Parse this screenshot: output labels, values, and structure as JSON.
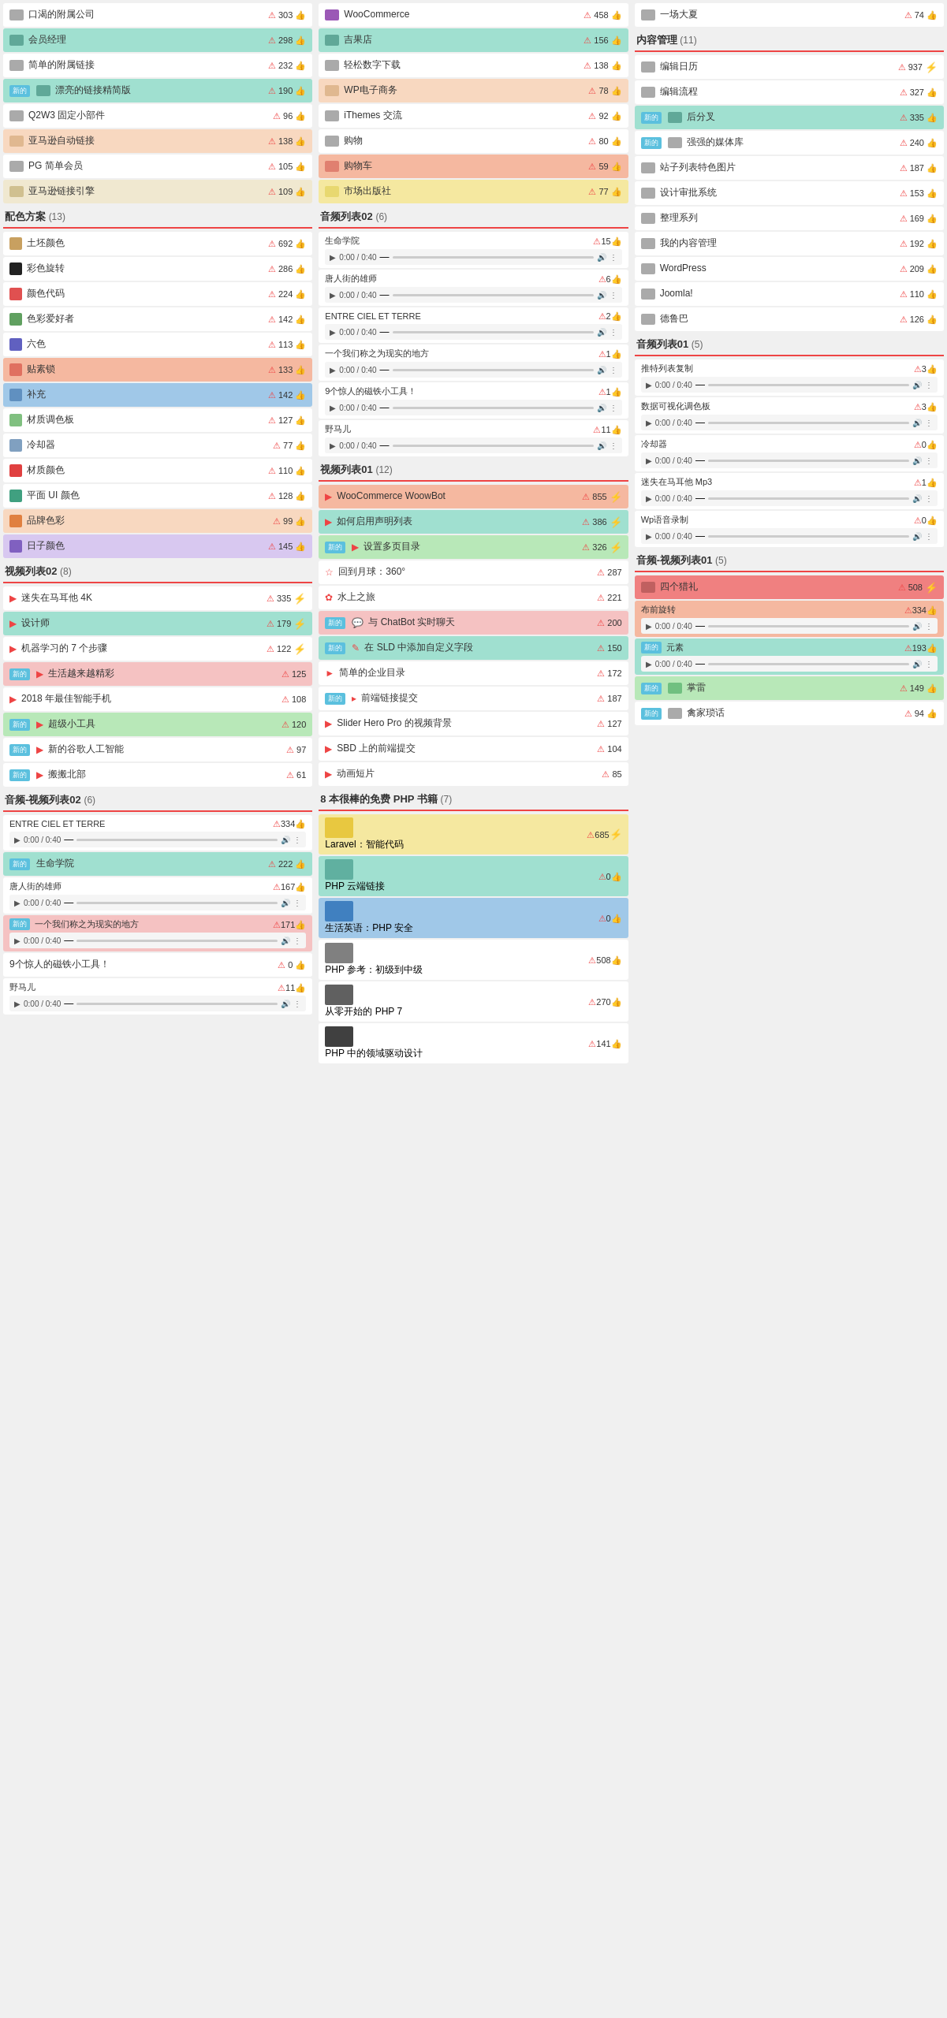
{
  "col1": {
    "topItems": [
      {
        "label": "口渴的附属公司",
        "alert": true,
        "count": 303,
        "likes": "",
        "bg": "white"
      },
      {
        "label": "会员经理",
        "alert": true,
        "count": 298,
        "likes": "",
        "bg": "teal"
      },
      {
        "label": "简单的附属链接",
        "alert": true,
        "count": 232,
        "likes": "",
        "bg": "white"
      },
      {
        "label": "漂亮的链接精简版",
        "badge": "新的",
        "alert": true,
        "count": 190,
        "likes": "",
        "bg": "teal"
      },
      {
        "label": "Q2W3 固定小部件",
        "alert": true,
        "count": 96,
        "likes": "",
        "bg": "white"
      },
      {
        "label": "亚马逊自动链接",
        "alert": true,
        "count": 138,
        "likes": "",
        "bg": "peach"
      },
      {
        "label": "PG 简单会员",
        "alert": true,
        "count": 105,
        "likes": "",
        "bg": "white"
      },
      {
        "label": "亚马逊链接引擎",
        "alert": true,
        "count": 109,
        "likes": "",
        "bg": "beige"
      }
    ],
    "colorSection": {
      "title": "配色方案",
      "count": 13,
      "items": [
        {
          "label": "土坯颜色",
          "color": "#c8a060",
          "alert": true,
          "count": 692,
          "bg": "white"
        },
        {
          "label": "彩色旋转",
          "color": "#222",
          "alert": true,
          "count": 286,
          "bg": "white"
        },
        {
          "label": "颜色代码",
          "color": "#e05050",
          "alert": true,
          "count": 224,
          "bg": "white"
        },
        {
          "label": "色彩爱好者",
          "color": "#60a060",
          "alert": true,
          "count": 142,
          "bg": "white"
        },
        {
          "label": "六色",
          "color": "#6060c0",
          "alert": true,
          "count": 113,
          "bg": "white"
        },
        {
          "label": "贴素锁",
          "color": "#e07060",
          "alert": true,
          "count": 133,
          "bg": "salmon"
        },
        {
          "label": "补充",
          "color": "#6090c0",
          "alert": true,
          "count": 142,
          "bg": "blue"
        },
        {
          "label": "材质调色板",
          "color": "#80c080",
          "alert": true,
          "count": 127,
          "bg": "white"
        },
        {
          "label": "冷却器",
          "color": "#80a0c0",
          "alert": true,
          "count": 77,
          "bg": "white"
        },
        {
          "label": "材质颜色",
          "color": "#e04040",
          "alert": true,
          "count": 110,
          "bg": "white"
        },
        {
          "label": "平面 UI 颜色",
          "color": "#40a080",
          "alert": true,
          "count": 128,
          "bg": "white"
        },
        {
          "label": "品牌色彩",
          "color": "#e08040",
          "alert": true,
          "count": 99,
          "bg": "peach"
        },
        {
          "label": "日子颜色",
          "color": "#8060c0",
          "alert": true,
          "count": 145,
          "bg": "lavender"
        }
      ]
    },
    "videoSection2": {
      "title": "视频列表02",
      "count": 8,
      "items": [
        {
          "label": "迷失在马耳他 4K",
          "alert": true,
          "count": 335,
          "lightning": true,
          "bg": "white"
        },
        {
          "label": "设计师",
          "alert": true,
          "count": 179,
          "lightning": true,
          "bg": "teal"
        },
        {
          "label": "机器学习的 7 个步骤",
          "alert": true,
          "count": 122,
          "lightning": true,
          "bg": "white"
        },
        {
          "label": "生活越来越精彩",
          "badge": "新的",
          "alert": true,
          "count": 125,
          "bg": "pink"
        },
        {
          "label": "2018 年最佳智能手机",
          "alert": true,
          "count": 108,
          "bg": "white"
        },
        {
          "label": "超级小工具",
          "badge": "新的",
          "alert": true,
          "count": 120,
          "bg": "green"
        },
        {
          "label": "新的谷歌人工智能",
          "badge": "新的",
          "alert": true,
          "count": 97,
          "bg": "white"
        },
        {
          "label": "搬搬北部",
          "badge": "新的",
          "alert": true,
          "count": 61,
          "bg": "white"
        }
      ]
    },
    "audioVideoSection2": {
      "title": "音频-视频列表02",
      "count": 6,
      "items": [
        {
          "label": "ENTRE CIEL ET TERRE",
          "hasPlayer": true,
          "alert": true,
          "count": 334,
          "bg": "white"
        },
        {
          "label": "生命学院",
          "badge": "新的",
          "alert": true,
          "count": 222,
          "bg": "teal"
        },
        {
          "label": "唐人街的雄师",
          "hasPlayer": true,
          "alert": true,
          "count": 167,
          "bg": "white"
        },
        {
          "label": "一个我们称之为现实的地方",
          "badge": "新的",
          "hasPlayer": true,
          "alert": true,
          "count": 171,
          "bg": "pink"
        },
        {
          "label": "9个惊人的磁铁小工具！",
          "alert": true,
          "count": 0,
          "bg": "white"
        },
        {
          "label": "野马儿",
          "hasPlayer": true,
          "alert": true,
          "count": 11,
          "bg": "white"
        }
      ]
    }
  },
  "col2": {
    "topItems": [
      {
        "label": "WooCommerce",
        "alert": true,
        "count": 458,
        "bg": "white"
      },
      {
        "label": "吉果店",
        "alert": true,
        "count": 156,
        "bg": "teal"
      },
      {
        "label": "轻松数字下载",
        "alert": true,
        "count": 138,
        "bg": "white"
      },
      {
        "label": "WP电子商务",
        "alert": true,
        "count": 78,
        "bg": "peach"
      },
      {
        "label": "iThemes 交流",
        "alert": true,
        "count": 92,
        "bg": "white"
      },
      {
        "label": "购物",
        "alert": true,
        "count": 80,
        "bg": "white"
      },
      {
        "label": "购物车",
        "alert": true,
        "count": 59,
        "bg": "salmon"
      },
      {
        "label": "市场出版社",
        "alert": true,
        "count": 77,
        "bg": "yellow"
      }
    ],
    "audioSection": {
      "title": "音频列表02",
      "count": 6,
      "items": [
        {
          "label": "生命学院",
          "hasPlayer": true,
          "alert": true,
          "count": 15,
          "bg": "white"
        },
        {
          "label": "唐人街的雄师",
          "hasPlayer": true,
          "alert": true,
          "count": 6,
          "bg": "white"
        },
        {
          "label": "ENTRE CIEL ET TERRE",
          "hasPlayer": true,
          "alert": true,
          "count": 2,
          "bg": "white"
        },
        {
          "label": "一个我们称之为现实的地方",
          "hasPlayer": true,
          "alert": true,
          "count": 1,
          "bg": "white"
        },
        {
          "label": "9个惊人的磁铁小工具！",
          "hasPlayer": true,
          "alert": true,
          "count": 1,
          "bg": "white"
        },
        {
          "label": "野马儿",
          "hasPlayer": true,
          "alert": true,
          "count": 11,
          "bg": "white"
        }
      ]
    },
    "videoSection1": {
      "title": "视频列表01",
      "count": 12,
      "items": [
        {
          "label": "WooCommerce WoowBot",
          "alert": true,
          "count": 855,
          "lightning": true,
          "bg": "salmon"
        },
        {
          "label": "如何启用声明列表",
          "alert": true,
          "count": 386,
          "lightning": true,
          "bg": "teal"
        },
        {
          "label": "设置多页目录",
          "badge": "新的",
          "alert": true,
          "count": 326,
          "lightning": true,
          "bg": "green"
        },
        {
          "label": "回到月球：360°",
          "alert": true,
          "count": 287,
          "bg": "white"
        },
        {
          "label": "水上之旅",
          "alert": true,
          "count": 221,
          "bg": "white"
        },
        {
          "label": "与 ChatBot 实时聊天",
          "badge": "新的",
          "alert": true,
          "count": 200,
          "bg": "pink"
        },
        {
          "label": "在 SLD 中添加自定义字段",
          "badge": "新的",
          "alert": true,
          "count": 150,
          "bg": "teal"
        },
        {
          "label": "简单的企业目录",
          "alert": true,
          "count": 172,
          "bg": "white"
        },
        {
          "label": "前端链接提交",
          "badge": "新的",
          "alert": true,
          "count": 187,
          "bg": "white"
        },
        {
          "label": "Slider Hero Pro 的视频背景",
          "alert": true,
          "count": 127,
          "bg": "white"
        },
        {
          "label": "SBD 上的前端提交",
          "alert": true,
          "count": 104,
          "bg": "white"
        },
        {
          "label": "动画短片",
          "alert": true,
          "count": 85,
          "bg": "white"
        }
      ]
    },
    "phpSection": {
      "title": "8 本很棒的免费 PHP 书籍",
      "count": 7,
      "items": [
        {
          "label": "Laravel：智能代码",
          "alert": true,
          "count": 685,
          "lightning": true,
          "bg": "yellow",
          "thumbColor": "#e8c840"
        },
        {
          "label": "PHP 云端链接",
          "alert": true,
          "count": 0,
          "bg": "teal",
          "thumbColor": "#60b0a0"
        },
        {
          "label": "生活英语：PHP 安全",
          "alert": true,
          "count": 0,
          "bg": "blue",
          "thumbColor": "#4080c0"
        },
        {
          "label": "PHP 参考：初级到中级",
          "alert": true,
          "count": 508,
          "bg": "white",
          "thumbColor": "#808080"
        },
        {
          "label": "从零开始的 PHP 7",
          "alert": true,
          "count": 270,
          "bg": "white",
          "thumbColor": "#606060"
        },
        {
          "label": "PHP 中的领域驱动设计",
          "alert": true,
          "count": 141,
          "bg": "white",
          "thumbColor": "#404040"
        }
      ]
    }
  },
  "col3": {
    "topItems": [
      {
        "label": "一场大夏",
        "alert": true,
        "count": 74,
        "bg": "white"
      }
    ],
    "contentSection": {
      "title": "内容管理",
      "count": 11,
      "items": [
        {
          "label": "编辑日历",
          "alert": true,
          "count": 937,
          "lightning": true,
          "bg": "white"
        },
        {
          "label": "编辑流程",
          "alert": true,
          "count": 327,
          "bg": "white"
        },
        {
          "label": "后分叉",
          "badge": "新的",
          "alert": true,
          "count": 335,
          "bg": "teal"
        },
        {
          "label": "强强的媒体库",
          "badge": "新的",
          "alert": true,
          "count": 240,
          "bg": "white"
        },
        {
          "label": "站子列表特色图片",
          "alert": true,
          "count": 187,
          "bg": "white"
        },
        {
          "label": "设计审批系统",
          "alert": true,
          "count": 153,
          "bg": "white"
        },
        {
          "label": "整理系列",
          "alert": true,
          "count": 169,
          "bg": "white"
        },
        {
          "label": "我的内容管理",
          "alert": true,
          "count": 192,
          "bg": "white"
        },
        {
          "label": "WordPress",
          "alert": true,
          "count": 209,
          "bg": "white"
        },
        {
          "label": "Joomla!",
          "alert": true,
          "count": 110,
          "bg": "white"
        },
        {
          "label": "德鲁巴",
          "alert": true,
          "count": 126,
          "bg": "white"
        }
      ]
    },
    "audioSection1": {
      "title": "音频列表01",
      "count": 5,
      "items": [
        {
          "label": "推特列表复制",
          "hasPlayer": true,
          "alert": true,
          "count": 3,
          "bg": "white"
        },
        {
          "label": "数据可视化调色板",
          "hasPlayer": true,
          "alert": true,
          "count": 3,
          "bg": "white"
        },
        {
          "label": "冷却器",
          "hasPlayer": true,
          "alert": true,
          "count": 0,
          "bg": "white"
        },
        {
          "label": "迷失在马耳他 Mp3",
          "hasPlayer": true,
          "alert": true,
          "count": 1,
          "bg": "white"
        },
        {
          "label": "Wp语音录制",
          "hasPlayer": true,
          "alert": true,
          "count": 0,
          "bg": "white"
        }
      ]
    },
    "audioVideoSection1": {
      "title": "音频-视频列表01",
      "count": 5,
      "items": [
        {
          "label": "四个猎礼",
          "alert": true,
          "count": 508,
          "lightning": true,
          "bg": "red-light"
        },
        {
          "label": "布前旋转",
          "hasPlayer": true,
          "alert": true,
          "count": 334,
          "bg": "salmon"
        },
        {
          "label": "元素",
          "badge": "新的",
          "hasPlayer": true,
          "alert": true,
          "count": 193,
          "bg": "teal"
        },
        {
          "label": "掌雷",
          "badge": "新的",
          "alert": true,
          "count": 149,
          "bg": "green"
        },
        {
          "label": "禽家琐话",
          "badge": "新的",
          "alert": true,
          "count": 94,
          "bg": "white"
        }
      ]
    }
  },
  "labels": {
    "new": "新的",
    "alert_icon": "⚠",
    "like_icon": "👍",
    "play": "▶",
    "pause": "⏸",
    "time": "0:00 / 0:40",
    "more": "⋮",
    "lightning_icon": "⚡"
  }
}
